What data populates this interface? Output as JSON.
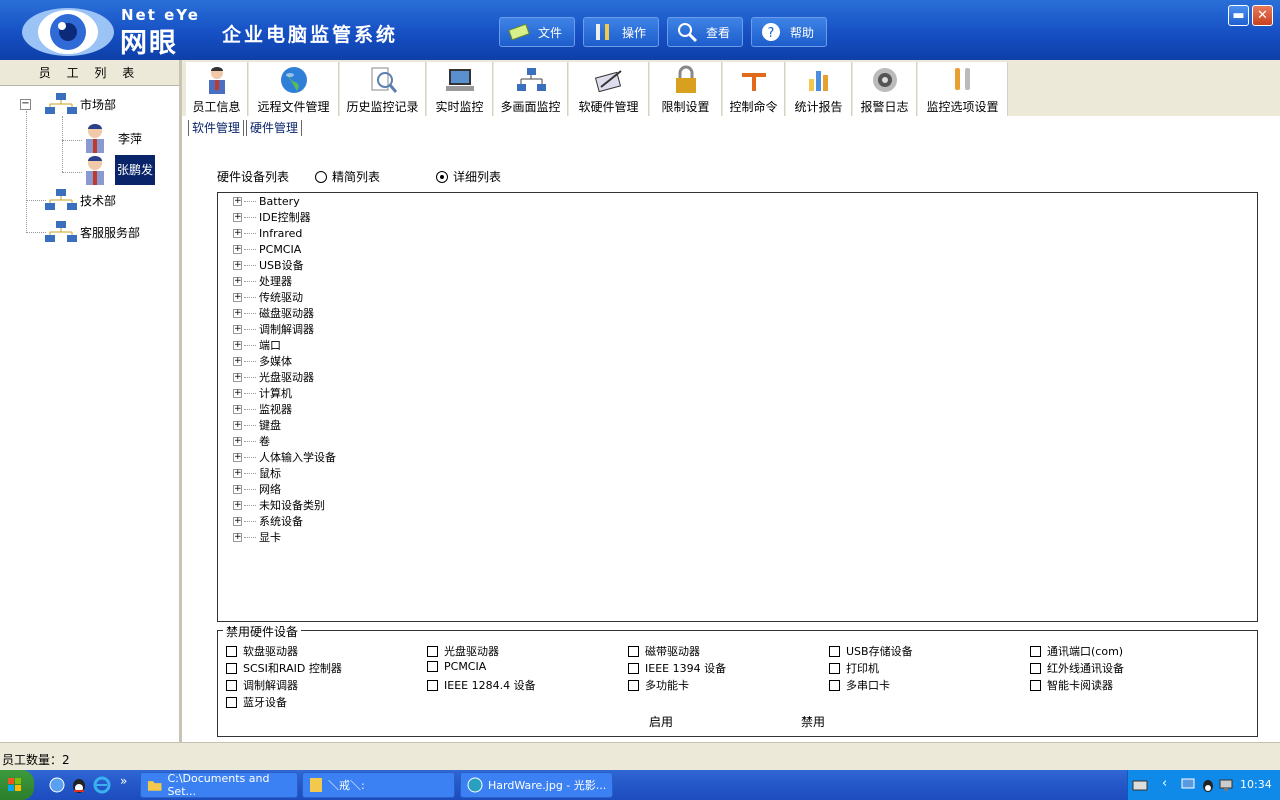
{
  "header": {
    "brand_en": "Net eYe",
    "brand_cn": "网眼",
    "title": "企业电脑监管系统",
    "menu": [
      {
        "label": "文件",
        "icon": "file-icon"
      },
      {
        "label": "操作",
        "icon": "tools-icon"
      },
      {
        "label": "查看",
        "icon": "magnifier-icon"
      },
      {
        "label": "帮助",
        "icon": "help-icon"
      }
    ],
    "window_controls": {
      "minimize": "▬",
      "close": "✕"
    }
  },
  "left": {
    "title": "员 工 列 表",
    "tree": [
      {
        "label": "市场部",
        "expander": "−"
      },
      {
        "label": "李萍"
      },
      {
        "label": "张鹏发",
        "selected": true
      },
      {
        "label": "技术部"
      },
      {
        "label": "客服服务部"
      }
    ]
  },
  "toolbar": [
    {
      "label": "员工信息",
      "icon": "person-icon"
    },
    {
      "label": "远程文件管理",
      "icon": "globe-icon"
    },
    {
      "label": "历史监控记录",
      "icon": "search-doc-icon"
    },
    {
      "label": "实时监控",
      "icon": "laptop-icon"
    },
    {
      "label": "多画面监控",
      "icon": "network-icon"
    },
    {
      "label": "软硬件管理",
      "icon": "box-icon",
      "active": true
    },
    {
      "label": "限制设置",
      "icon": "lock-icon"
    },
    {
      "label": "控制命令",
      "icon": "card-icon"
    },
    {
      "label": "统计报告",
      "icon": "chart-icon"
    },
    {
      "label": "报警日志",
      "icon": "speaker-icon"
    },
    {
      "label": "监控选项设置",
      "icon": "wrench-icon"
    }
  ],
  "subtabs": [
    "软件管理",
    "硬件管理"
  ],
  "hw": {
    "list_label": "硬件设备列表",
    "radio_simple": "精简列表",
    "radio_detail": "详细列表",
    "items": [
      "Battery",
      "IDE控制器",
      "Infrared",
      "PCMCIA",
      "USB设备",
      "处理器",
      "传统驱动",
      "磁盘驱动器",
      "调制解调器",
      "端口",
      "多媒体",
      "光盘驱动器",
      "计算机",
      "监视器",
      "键盘",
      "卷",
      "人体输入学设备",
      "鼠标",
      "网络",
      "未知设备类别",
      "系统设备",
      "显卡"
    ],
    "expander": "+"
  },
  "disable": {
    "legend": "禁用硬件设备",
    "items": [
      "软盘驱动器",
      "光盘驱动器",
      "磁带驱动器",
      "USB存储设备",
      "通讯端口(com)",
      "SCSI和RAID 控制器",
      "PCMCIA",
      "IEEE 1394 设备",
      "打印机",
      "红外线通讯设备",
      "调制解调器",
      "IEEE 1284.4 设备",
      "多功能卡",
      "多串口卡",
      "智能卡阅读器",
      "蓝牙设备"
    ],
    "enable_btn": "启用",
    "disable_btn": "禁用"
  },
  "status": {
    "text": "员工数量：2"
  },
  "taskbar": {
    "items": [
      "C:\\Documents and Set...",
      "＼戒＼:",
      "HardWare.jpg - 光影..."
    ],
    "clock": "10:34",
    "chevron": "»",
    "tray_arrow": "‹"
  }
}
